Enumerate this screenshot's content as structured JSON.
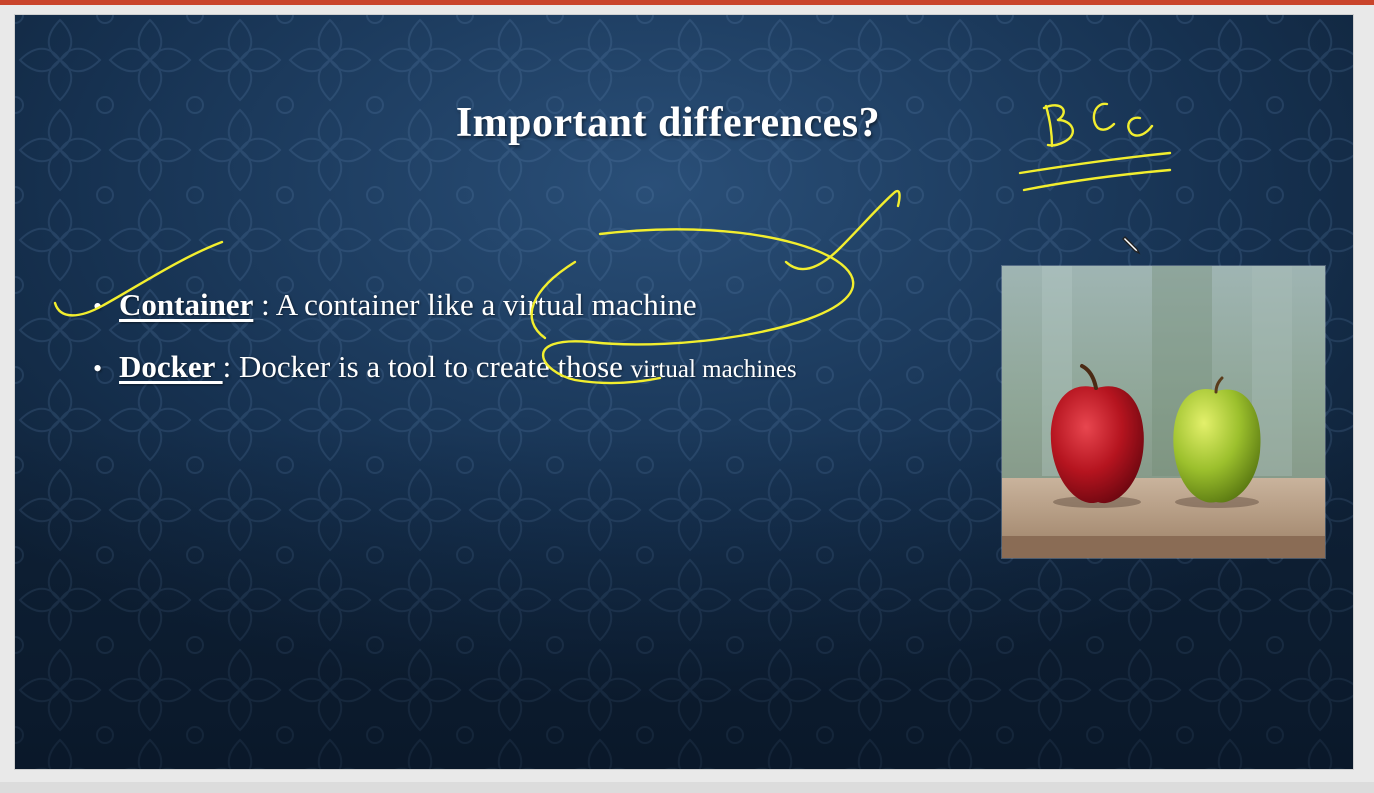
{
  "slide": {
    "title": "Important differences?",
    "bullets": [
      {
        "term": "Container",
        "separator": " : ",
        "text": "A container like a virtual machine"
      },
      {
        "term": "Docker ",
        "separator": ": ",
        "text": "Docker is a tool to create those ",
        "text_small": "virtual machines"
      }
    ],
    "image": {
      "icon": "apples-photo-icon"
    }
  },
  "annotations": {
    "ink_color": "#f2ee2e",
    "handwritten_note": "BCC"
  },
  "colors": {
    "accent_bar": "#c9442b",
    "slide_background": "#1f3f63",
    "text": "#ffffff"
  },
  "cursor": {
    "icon": "pen-cursor-icon"
  }
}
